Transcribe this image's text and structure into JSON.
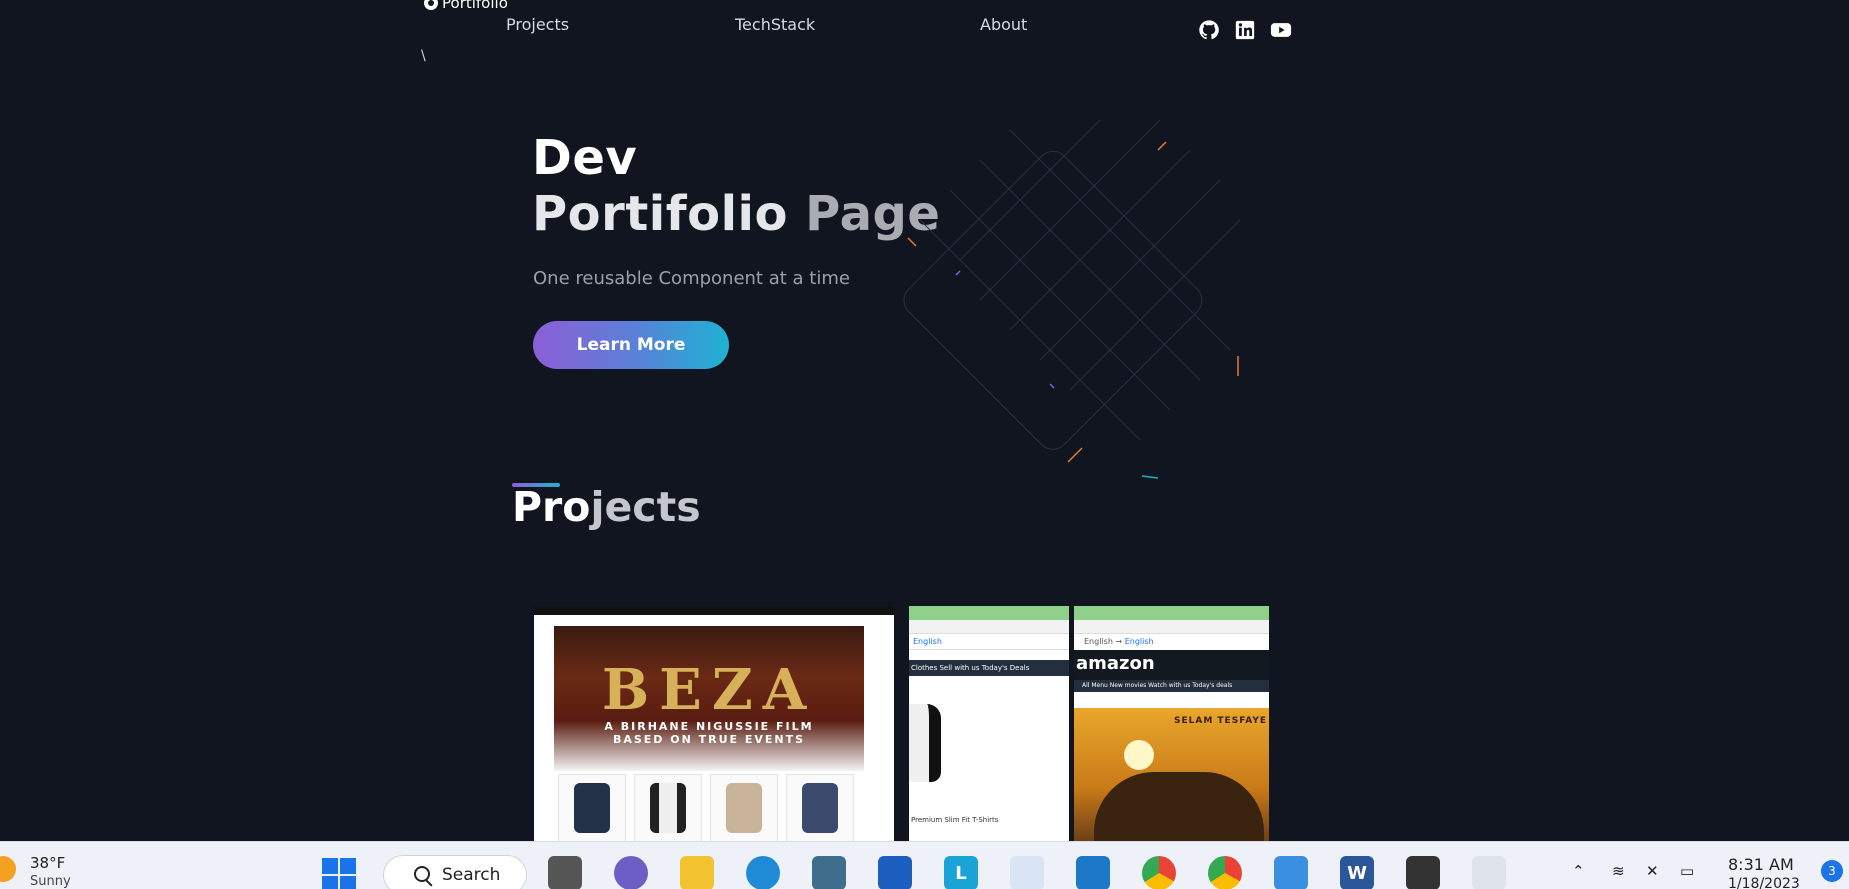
{
  "nav": {
    "logo_text": "Portifolio",
    "backslash": "\\",
    "links": [
      "Projects",
      "TechStack",
      "About"
    ],
    "social_icons": [
      "github-icon",
      "linkedin-icon",
      "youtube-icon"
    ]
  },
  "hero": {
    "title_line1": "Dev",
    "title_line2_a": "Portifolio",
    "title_line2_b": " Page",
    "tagline": "One reusable Component at a time",
    "cta_label": "Learn More"
  },
  "projects": {
    "heading_a": "Pro",
    "heading_b": "jects",
    "cards": [
      {
        "title": "BEZA",
        "subtitle1": "A BIRHANE NIGUSSIE FILM",
        "subtitle2": "BASED ON TRUE EVENTS"
      },
      {
        "lang": "English",
        "nav": "Clothes Sell with us Today's Deals",
        "caption": "Premium Slim Fit T-Shirts"
      },
      {
        "brand": "amazon",
        "lang_from": "English",
        "lang_to": "English",
        "nav": "All  Menu  New movies  Watch with us  Today's deals",
        "poster_name": "SELAM TESFAYE"
      }
    ]
  },
  "taskbar": {
    "weather_temp": "38°F",
    "weather_cond": "Sunny",
    "search_label": "Search",
    "clock_time": "8:31 AM",
    "clock_date": "1/18/2023",
    "notification_count": "3",
    "colors": {
      "accent": "#1a73e8"
    }
  }
}
